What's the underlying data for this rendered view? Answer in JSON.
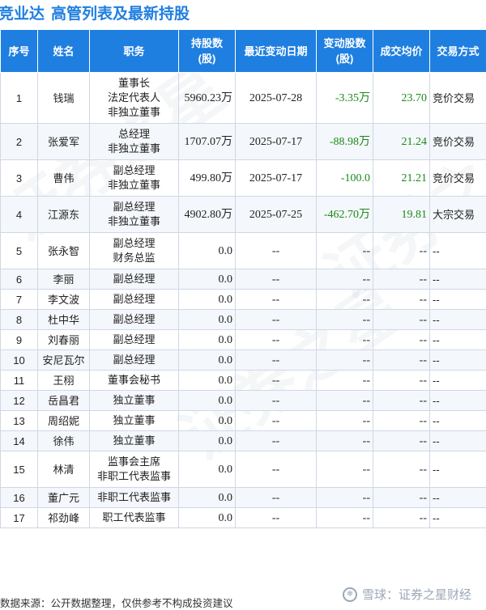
{
  "title": {
    "company": "竞业达",
    "heading": "高管列表及最新持股"
  },
  "columns": [
    "序号",
    "姓名",
    "职务",
    "持股数\n(股)",
    "最近变动日期",
    "变动股数\n(股)",
    "成交均价",
    "交易方式"
  ],
  "rows": [
    {
      "no": "1",
      "name": "钱瑞",
      "position": "董事长\n法定代表人\n非独立董事",
      "shares": "5960.23万",
      "date": "2025-07-28",
      "change": "-3.35万",
      "price": "23.70",
      "method": "竞价交易",
      "h": 3
    },
    {
      "no": "2",
      "name": "张爱军",
      "position": "总经理\n非独立董事",
      "shares": "1707.07万",
      "date": "2025-07-17",
      "change": "-88.98万",
      "price": "21.24",
      "method": "竞价交易",
      "h": 2
    },
    {
      "no": "3",
      "name": "曹伟",
      "position": "副总经理\n非独立董事",
      "shares": "499.80万",
      "date": "2025-07-17",
      "change": "-100.0",
      "price": "21.21",
      "method": "竞价交易",
      "h": 2
    },
    {
      "no": "4",
      "name": "江源东",
      "position": "副总经理\n非独立董事",
      "shares": "4902.80万",
      "date": "2025-07-25",
      "change": "-462.70万",
      "price": "19.81",
      "method": "大宗交易",
      "h": 2
    },
    {
      "no": "5",
      "name": "张永智",
      "position": "副总经理\n财务总监",
      "shares": "0.0",
      "date": "--",
      "change": "--",
      "price": "--",
      "method": "--",
      "h": 2
    },
    {
      "no": "6",
      "name": "李丽",
      "position": "副总经理",
      "shares": "0.0",
      "date": "--",
      "change": "--",
      "price": "--",
      "method": "--",
      "h": 1
    },
    {
      "no": "7",
      "name": "李文波",
      "position": "副总经理",
      "shares": "0.0",
      "date": "--",
      "change": "--",
      "price": "--",
      "method": "--",
      "h": 1
    },
    {
      "no": "8",
      "name": "杜中华",
      "position": "副总经理",
      "shares": "0.0",
      "date": "--",
      "change": "--",
      "price": "--",
      "method": "--",
      "h": 1
    },
    {
      "no": "9",
      "name": "刘春丽",
      "position": "副总经理",
      "shares": "0.0",
      "date": "--",
      "change": "--",
      "price": "--",
      "method": "--",
      "h": 1
    },
    {
      "no": "10",
      "name": "安尼瓦尔",
      "position": "副总经理",
      "shares": "0.0",
      "date": "--",
      "change": "--",
      "price": "--",
      "method": "--",
      "h": 1
    },
    {
      "no": "11",
      "name": "王栩",
      "position": "董事会秘书",
      "shares": "0.0",
      "date": "--",
      "change": "--",
      "price": "--",
      "method": "--",
      "h": 1
    },
    {
      "no": "12",
      "name": "岳昌君",
      "position": "独立董事",
      "shares": "0.0",
      "date": "--",
      "change": "--",
      "price": "--",
      "method": "--",
      "h": 1
    },
    {
      "no": "13",
      "name": "周绍妮",
      "position": "独立董事",
      "shares": "0.0",
      "date": "--",
      "change": "--",
      "price": "--",
      "method": "--",
      "h": 1
    },
    {
      "no": "14",
      "name": "徐伟",
      "position": "独立董事",
      "shares": "0.0",
      "date": "--",
      "change": "--",
      "price": "--",
      "method": "--",
      "h": 1
    },
    {
      "no": "15",
      "name": "林清",
      "position": "监事会主席\n非职工代表监事",
      "shares": "0.0",
      "date": "--",
      "change": "--",
      "price": "--",
      "method": "--",
      "h": 2
    },
    {
      "no": "16",
      "name": "董广元",
      "position": "非职工代表监事",
      "shares": "0.0",
      "date": "--",
      "change": "--",
      "price": "--",
      "method": "--",
      "h": 1
    },
    {
      "no": "17",
      "name": "祁劲峰",
      "position": "职工代表监事",
      "shares": "0.0",
      "date": "--",
      "change": "--",
      "price": "--",
      "method": "--",
      "h": 1
    }
  ],
  "footer": "数据来源：公开数据整理，仅供参考不构成投资建议",
  "brand": "雪球：证券之星财经",
  "watermark": "证券之星",
  "colors": {
    "header_bg": "#1f7fe0",
    "positive": "#1a8a1a",
    "title": "#1f7fe0"
  }
}
